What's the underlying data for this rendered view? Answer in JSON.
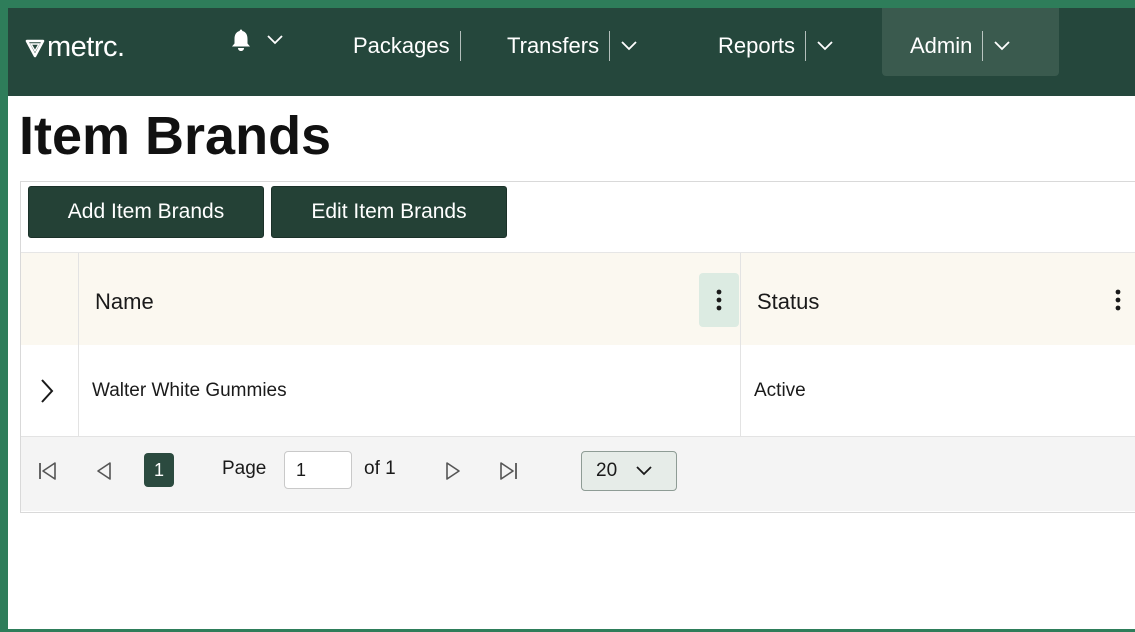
{
  "app": {
    "logo_text": "metrc"
  },
  "nav": {
    "items": [
      {
        "label": "Packages"
      },
      {
        "label": "Transfers"
      },
      {
        "label": "Reports"
      },
      {
        "label": "Admin"
      }
    ],
    "icons": [
      "bell-icon",
      "chevron-down-icon"
    ]
  },
  "page": {
    "title": "Item Brands"
  },
  "toolbar": {
    "add_label": "Add Item Brands",
    "edit_label": "Edit Item Brands"
  },
  "table": {
    "columns": [
      {
        "label": "Name"
      },
      {
        "label": "Status"
      }
    ],
    "rows": [
      {
        "name": "Walter White Gummies",
        "status": "Active"
      }
    ]
  },
  "pager": {
    "current_page": "1",
    "page_label": "Page",
    "page_input_value": "1",
    "of_label": "of 1",
    "page_size": "20"
  },
  "colors": {
    "nav_bg": "#25473c",
    "button_bg": "#244136",
    "frame_border": "#2e7d5a"
  }
}
